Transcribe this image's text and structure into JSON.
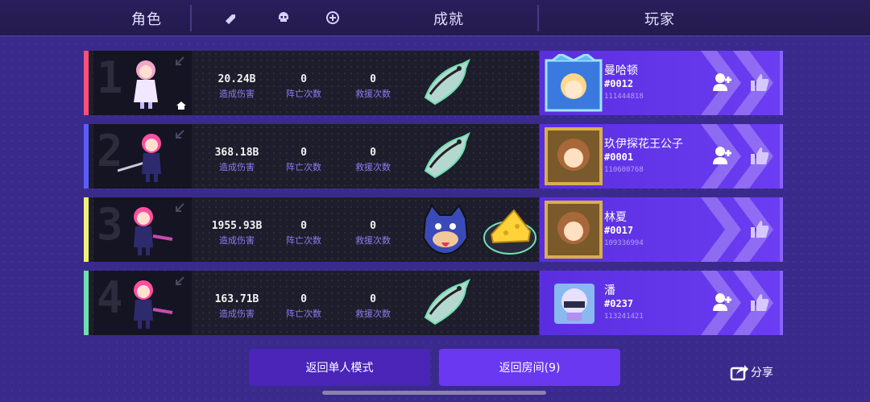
{
  "header": {
    "role_label": "角色",
    "achievement_label": "成就",
    "player_label": "玩家"
  },
  "stat_labels": {
    "damage": "造成伤害",
    "deaths": "阵亡次数",
    "rescues": "救援次数"
  },
  "colors": {
    "rank1": "#ff4f7a",
    "rank2": "#5a5cff",
    "rank3": "#eef07a",
    "rank4": "#6ee0b0",
    "player_panel": "#6a38f0",
    "stat_label": "#8c7cf0"
  },
  "rows": [
    {
      "rank": "1",
      "damage": "20.24B",
      "deaths": "0",
      "rescues": "0",
      "achievements": [
        "fish-icon"
      ],
      "player": {
        "name": "曼哈顿",
        "tag": "#0012",
        "id": "111444818",
        "show_add_friend": true
      },
      "host": true
    },
    {
      "rank": "2",
      "damage": "368.18B",
      "deaths": "0",
      "rescues": "0",
      "achievements": [
        "fish-icon"
      ],
      "player": {
        "name": "玖伊探花王公子",
        "tag": "#0001",
        "id": "110600768",
        "show_add_friend": true
      },
      "host": false
    },
    {
      "rank": "3",
      "damage": "1955.93B",
      "deaths": "0",
      "rescues": "0",
      "achievements": [
        "wolf-icon",
        "cheese-icon"
      ],
      "player": {
        "name": "林夏",
        "tag": "#0017",
        "id": "109336994",
        "show_add_friend": false
      },
      "host": false
    },
    {
      "rank": "4",
      "damage": "163.71B",
      "deaths": "0",
      "rescues": "0",
      "achievements": [
        "fish-icon"
      ],
      "player": {
        "name": "潘",
        "tag": "#0237",
        "id": "113241421",
        "show_add_friend": true
      },
      "host": false
    }
  ],
  "footer": {
    "single_mode_button": "返回单人模式",
    "room_button": "返回房间(9)",
    "share_label": "分享"
  }
}
